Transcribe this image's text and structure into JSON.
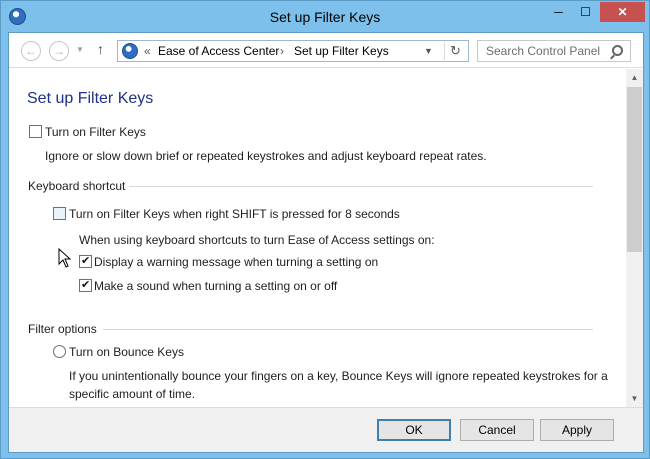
{
  "window": {
    "title": "Set up Filter Keys",
    "icon": "ease-of-access-icon",
    "controls": {
      "minimize": "─",
      "maximize": "☐",
      "close": "✕"
    }
  },
  "address_bar": {
    "breadcrumbs": [
      "Ease of Access Center",
      "Set up Filter Keys"
    ],
    "overflow_chevron": "«",
    "separator": "›"
  },
  "search": {
    "placeholder": "Search Control Panel"
  },
  "page": {
    "title": "Set up Filter Keys",
    "turn_on_filter_keys": {
      "label": "Turn on Filter Keys",
      "checked": false
    },
    "filter_keys_description": "Ignore or slow down brief or repeated keystrokes and adjust keyboard repeat rates.",
    "keyboard_shortcut": {
      "heading": "Keyboard shortcut",
      "shift_option": {
        "label": "Turn on Filter Keys when right SHIFT is pressed for 8 seconds",
        "checked": false
      },
      "settings_intro": "When using keyboard shortcuts to turn Ease of Access settings on:",
      "warning_option": {
        "label": "Display a warning message when turning a setting on",
        "checked": true
      },
      "sound_option": {
        "label": "Make a sound when turning a setting on or off",
        "checked": true
      }
    },
    "filter_options": {
      "heading": "Filter options",
      "bounce_keys": {
        "label": "Turn on Bounce Keys",
        "selected": false
      },
      "bounce_description": "If you unintentionally bounce your fingers on a key, Bounce Keys will ignore repeated keystrokes for a specific amount of time."
    }
  },
  "footer": {
    "ok": "OK",
    "cancel": "Cancel",
    "apply": "Apply"
  },
  "colors": {
    "title_text": "#1e3287",
    "window_frame": "#7ec0ec",
    "close_button": "#c75050"
  }
}
